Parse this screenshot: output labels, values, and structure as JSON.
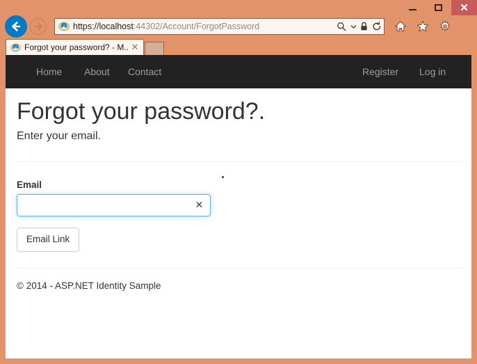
{
  "browser": {
    "window_controls": {
      "minimize": "–",
      "maximize": "□",
      "close": "✕"
    },
    "back_button_label": "Back",
    "forward_button_label": "Forward",
    "address": {
      "url_secure_host": "https://localhost",
      "url_path": ":44302/Account/ForgotPassword",
      "full_url": "https://localhost:44302/Account/ForgotPassword",
      "search_icon": "search-icon",
      "dropdown_icon": "chevron-down-icon",
      "lock_icon": "lock-icon",
      "refresh_icon": "refresh-icon"
    },
    "toolbar": {
      "home_icon": "home-icon",
      "favorites_icon": "star-icon",
      "settings_icon": "gear-icon"
    },
    "tab": {
      "title": "Forgot your password? - M...",
      "close_label": "✕",
      "favicon": "internet-explorer-icon"
    },
    "new_tab_label": ""
  },
  "site": {
    "nav": {
      "left_items": [
        {
          "label": "Home"
        },
        {
          "label": "About"
        },
        {
          "label": "Contact"
        }
      ],
      "right_items": [
        {
          "label": "Register"
        },
        {
          "label": "Log in"
        }
      ]
    },
    "main": {
      "title": "Forgot your password?.",
      "subtitle": "Enter your email.",
      "form": {
        "email_label": "Email",
        "email_value": "",
        "email_placeholder": "",
        "clear_icon": "✕",
        "submit_label": "Email Link"
      }
    },
    "footer": {
      "text": "© 2014 - ASP.NET Identity Sample"
    }
  },
  "colors": {
    "frame": "#e3936a",
    "navbar": "#222222",
    "close_button": "#c75b5b",
    "back_button": "#0479c4",
    "input_focus_border": "#66afe9",
    "page_background": "#ffffff"
  }
}
